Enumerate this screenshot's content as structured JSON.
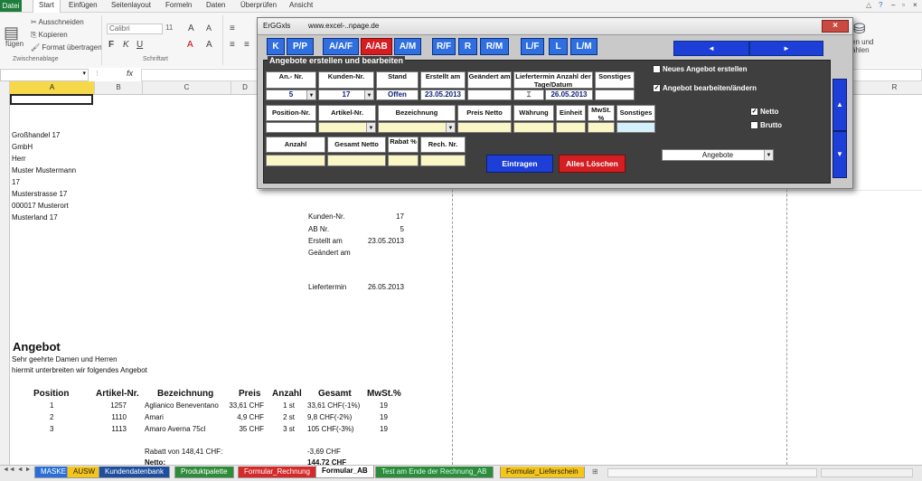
{
  "ribbon": {
    "tabs": [
      "Datei",
      "Start",
      "Einfügen",
      "Seitenlayout",
      "Formeln",
      "Daten",
      "Überprüfen",
      "Ansicht"
    ],
    "clipboard": {
      "cut": "Ausschneiden",
      "copy": "Kopieren",
      "format": "Format übertragen",
      "paste": "fügen",
      "group": "Zwischenablage"
    },
    "font": {
      "name": "Calibri",
      "size": "11",
      "group": "Schriftart",
      "bold": "F",
      "italic": "K",
      "underline": "U"
    },
    "right_group": "en und\nählen"
  },
  "formula_bar": {
    "fx": "fx"
  },
  "columns": [
    "A",
    "B",
    "C",
    "D",
    "R"
  ],
  "sheet": {
    "address": [
      "Großhandel 17",
      "GmbH",
      "Herr",
      "Muster Mustermann",
      "17",
      "Musterstrasse 17",
      "000017 Musterort",
      "Musterland 17"
    ],
    "meta": [
      {
        "label": "Kunden-Nr.",
        "value": "17"
      },
      {
        "label": "AB Nr.",
        "value": "5"
      },
      {
        "label": "Erstellt am",
        "value": "23.05.2013"
      },
      {
        "label": "Geändert am",
        "value": ""
      },
      {
        "label": "Liefertermin",
        "value": "26.05.2013"
      }
    ],
    "heading": "Angebot",
    "greeting": "Sehr geehrte Damen und Herren",
    "intro": "hiermit unterbreiten wir folgendes Angebot",
    "table_headers": [
      "Position",
      "Artikel-Nr.",
      "Bezeichnung",
      "Preis",
      "Anzahl",
      "Gesamt",
      "MwSt.%"
    ],
    "rows": [
      [
        "1",
        "1257",
        "Aglianico Beneventano",
        "33,61 CHF",
        "1 st",
        "33,61 CHF(-1%)",
        "19"
      ],
      [
        "2",
        "1110",
        "Amari",
        "4,9 CHF",
        "2 st",
        "9,8 CHF(-2%)",
        "19"
      ],
      [
        "3",
        "1113",
        "Amaro Averna 75cl",
        "35 CHF",
        "3 st",
        "105 CHF(-3%)",
        "19"
      ]
    ],
    "rabatt_label": "Rabatt von 148,41 CHF:",
    "rabatt_value": "-3,69 CHF",
    "netto_label": "Netto:",
    "netto_value": "144,72 CHF"
  },
  "sheet_tabs": [
    {
      "label": "MASKE",
      "color": "#2b6fd6"
    },
    {
      "label": "AUSW",
      "color": "#f5c518"
    },
    {
      "label": "Kundendatenbank",
      "color": "#1f4e9e"
    },
    {
      "label": "Produktpalette",
      "color": "#2e8b3a"
    },
    {
      "label": "Formular_Rechnung",
      "color": "#d42a2a"
    },
    {
      "label": "Formular_AB",
      "color": "#ffffff"
    },
    {
      "label": "Test am Ende der Rechnung_AB",
      "color": "#2e8b3a"
    },
    {
      "label": "Formular_Lieferschein",
      "color": "#f5c518"
    }
  ],
  "dialog": {
    "title": "ErGGxls",
    "url": "www.excel-..npage.de",
    "close": "×",
    "nav_buttons": [
      "K",
      "P/P",
      "A/A/F",
      "A/AB",
      "A/M",
      "R/F",
      "R",
      "R/M",
      "L/F",
      "L",
      "L/M"
    ],
    "active_nav": "A/AB",
    "prev": "◄",
    "next": "►",
    "frame_title": "Angebote erstellen und bearbeiten",
    "headers1": [
      "An.- Nr.",
      "Kunden-Nr.",
      "Stand",
      "Erstellt am",
      "Geändert am",
      "Liefertermin Anzahl der Tage/Datum",
      "Sonstiges"
    ],
    "an_nr": "5",
    "kunden_nr": "17",
    "stand": "Offen",
    "erstellt": "23.05.2013",
    "liefertermin": "26.05.2013",
    "headers2": [
      "Position-Nr.",
      "Artikel-Nr.",
      "Bezeichnung",
      "Preis Netto",
      "Währung",
      "Einheit",
      "MwSt. %",
      "Sonstiges"
    ],
    "headers3": [
      "Anzahl",
      "Gesamt Netto",
      "Rabat %",
      "Rech. Nr."
    ],
    "neues_angebot": "Neues Angebot erstellen",
    "bearbeiten": "Angebot bearbeiten/ändern",
    "netto": "Netto",
    "brutto": "Brutto",
    "eintragen": "Eintragen",
    "loeschen": "Alles Löschen",
    "angebote_select": "Angebote",
    "up": "▲",
    "down": "▼"
  }
}
